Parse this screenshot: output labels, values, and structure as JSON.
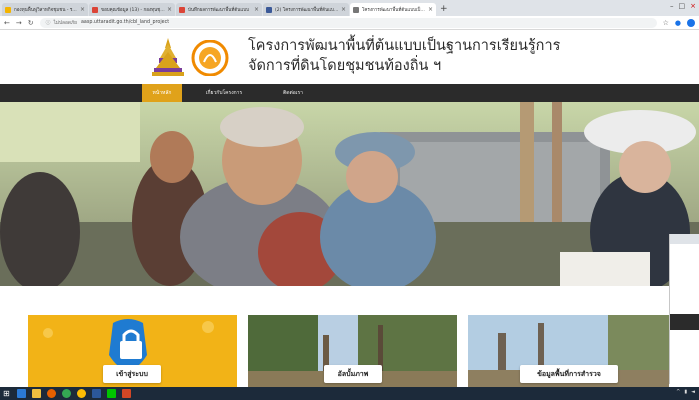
{
  "browser": {
    "tabs": [
      {
        "title": "กองทุนฟื้นฟูวิสาหกิจชุมชน - ระบบสารสนเทศ",
        "color": "#f4b400",
        "active": false
      },
      {
        "title": "ขอบคุณข้อมูล (13) - กองทุนชุมชน",
        "color": "#db4437",
        "active": false
      },
      {
        "title": "บันทึกผลการพัฒนาพื้นที่ต้นแบบ",
        "color": "#db4437",
        "active": false
      },
      {
        "title": "(2) โครงการพัฒนาพื้นที่ต้นแบบ | Facebook",
        "color": "#3b5998",
        "active": false
      },
      {
        "title": "โครงการพัฒนาพื้นที่ต้นแบบเป็นฐานการ",
        "color": "#777777",
        "active": true
      }
    ],
    "new_tab_label": "+",
    "back_icon": "back-arrow-icon",
    "forward_icon": "forward-arrow-icon",
    "reload_icon": "reload-icon",
    "security_label": "ไม่ปลอดภัย",
    "url": "aasp.uttaradit.go.th/cbl_land_project"
  },
  "site": {
    "title_line1": "โครงการพัฒนาพื้นที่ต้นแบบเป็นฐานการเรียนรู้การ",
    "title_line2": "จัดการที่ดินโดยชุมชนท้องถิ่น ฯ",
    "nav": [
      {
        "label": "หน้าหลัก",
        "active": true
      },
      {
        "label": "เกี่ยวกับโครงการ",
        "active": false
      },
      {
        "label": "ติดต่อเรา",
        "active": false
      }
    ]
  },
  "cards": [
    {
      "label": "เข้าสู่ระบบ"
    },
    {
      "label": "อัลบั้มภาพ"
    },
    {
      "label": "ข้อมูลพื้นที่การสำรวจ"
    }
  ],
  "colors": {
    "accent": "#e0a21a",
    "nav_bg": "#2b2b2b",
    "card_yellow": "#f2b317",
    "taskbar": "#1c2a3a"
  },
  "taskbar": {
    "icons": [
      "windows-start-icon",
      "edge-icon",
      "file-explorer-icon",
      "firefox-icon",
      "chrome-icon",
      "chrome-icon",
      "word-icon",
      "line-icon",
      "powerpoint-icon"
    ]
  }
}
